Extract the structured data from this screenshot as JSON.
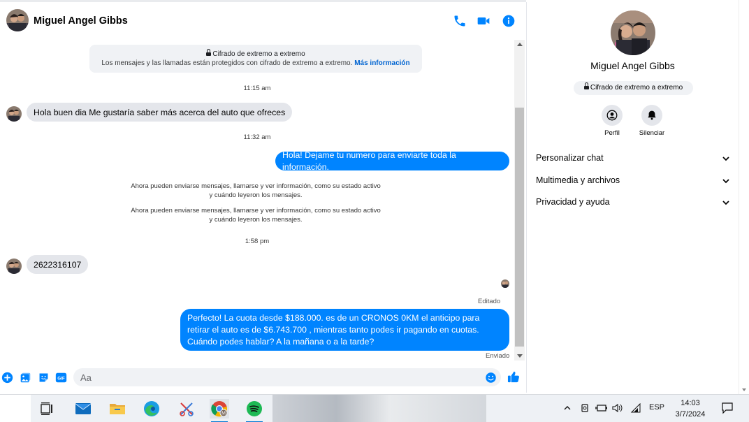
{
  "header": {
    "contact_name": "Miguel Angel Gibbs",
    "icons": [
      "phone-icon",
      "video-camera-icon",
      "info-icon"
    ]
  },
  "encryption_notice": {
    "title": "Cifrado de extremo a extremo",
    "body": "Los mensajes y las llamadas están protegidos con cifrado de extremo a extremo.",
    "link": "Más información"
  },
  "messages": {
    "time_1": "11:15 am",
    "incoming_1": "Hola buen dia Me gustaría saber más acerca del auto que ofreces",
    "time_2": "11:32 am",
    "outgoing_1": "Hola! Dejame tu numero  para enviarte toda la información.",
    "system_1": "Ahora pueden enviarse mensajes, llamarse y ver información, como su estado activo y cuándo leyeron los mensajes.",
    "system_2": "Ahora pueden enviarse mensajes, llamarse y ver información, como su estado activo y cuándo leyeron los mensajes.",
    "time_3": "1:58 pm",
    "incoming_2": "2622316107",
    "edited_label": "Editado",
    "outgoing_2": "Perfecto! La cuota desde $188.000. es de un CRONOS 0KM el anticipo para retirar el auto es de $6.743.700 , mientras tanto podes ir pagando en cuotas. Cuándo podes hablar? A la mañana o a la tarde?",
    "sent_label": "Enviado"
  },
  "composer": {
    "placeholder": "Aa",
    "icons": [
      "plus-icon",
      "image-icon",
      "sticker-icon",
      "gif-icon",
      "emoji-icon",
      "thumbs-up-icon"
    ],
    "gif_label": "GIF"
  },
  "right_panel": {
    "contact_name": "Miguel Angel Gibbs",
    "e2e_label": "Cifrado de extremo a extremo",
    "profile_label": "Perfil",
    "mute_label": "Silenciar",
    "sections": [
      "Personalizar chat",
      "Multimedia y archivos",
      "Privacidad y ayuda"
    ]
  },
  "taskbar": {
    "apps": [
      "task-view-icon",
      "mail-icon",
      "file-explorer-icon",
      "edge-icon",
      "snipping-tool-icon",
      "chrome-icon",
      "spotify-icon"
    ],
    "chrome_badge": "M",
    "language": "ESP",
    "time": "14:03",
    "date": "3/7/2024"
  },
  "colors": {
    "accent": "#0084ff",
    "link": "#0064d1",
    "incoming_bubble": "#e4e6eb",
    "spotify": "#1db954"
  }
}
